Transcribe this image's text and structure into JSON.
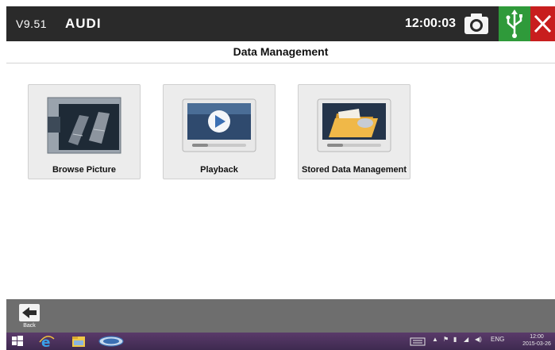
{
  "header": {
    "version": "V9.51",
    "make": "AUDI",
    "time": "12:00:03"
  },
  "page": {
    "title": "Data Management"
  },
  "tiles": [
    {
      "label": "Browse Picture",
      "icon": "browse-picture-icon"
    },
    {
      "label": "Playback",
      "icon": "playback-icon"
    },
    {
      "label": "Stored Data Management",
      "icon": "stored-data-icon"
    }
  ],
  "footer": {
    "back_label": "Back"
  },
  "taskbar": {
    "lang": "ENG",
    "time": "12:00",
    "date": "2015-03-26"
  },
  "colors": {
    "topbar": "#2a2a2a",
    "usb_green": "#2f9a3a",
    "close_red": "#c81e1e",
    "bottombar": "#6e6e6e"
  }
}
